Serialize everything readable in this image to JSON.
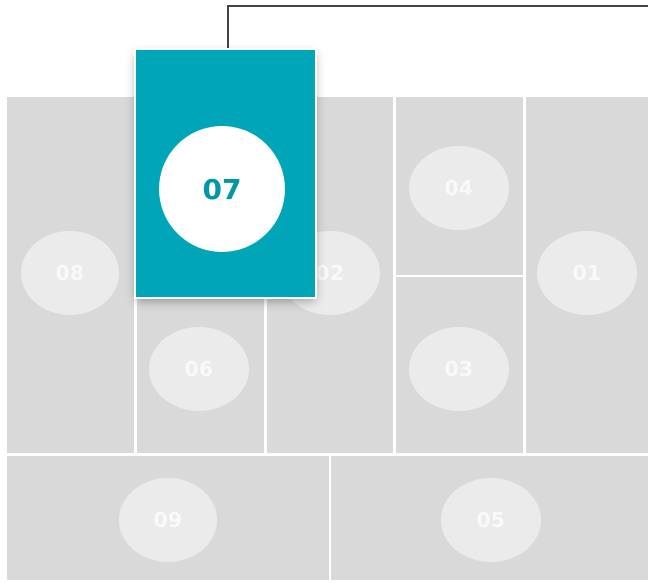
{
  "colors": {
    "cell_fill": "#d9d9d9",
    "badge_fill": "#ebebeb",
    "badge_text": "#f9f9f9",
    "highlight_fill": "#00a6b8",
    "highlight_text": "#0297a8",
    "leader_line": "#444444"
  },
  "cells": {
    "c01": "01",
    "c02": "02",
    "c03": "03",
    "c04": "04",
    "c05": "05",
    "c06": "06",
    "c07": "07",
    "c08": "08",
    "c09": "09"
  }
}
